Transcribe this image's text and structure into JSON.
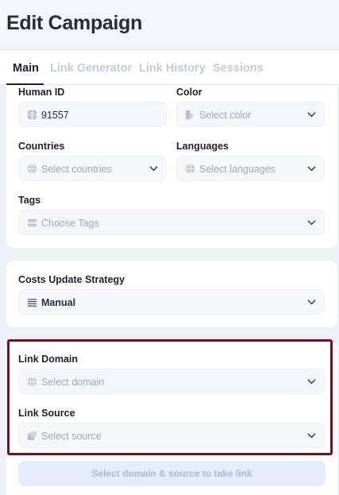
{
  "page_title": "Edit Campaign",
  "tabs": [
    {
      "label": "Main",
      "active": true
    },
    {
      "label": "Link Generator",
      "active": false
    },
    {
      "label": "Link History",
      "active": false
    },
    {
      "label": "Sessions",
      "active": false
    }
  ],
  "general": {
    "human_id": {
      "label": "Human ID",
      "value": "91557",
      "icon": "globe-icon"
    },
    "color": {
      "label": "Color",
      "placeholder": "Select color",
      "icon": "palette-icon"
    },
    "countries": {
      "label": "Countries",
      "placeholder": "Select countries",
      "icon": "globe-icon"
    },
    "languages": {
      "label": "Languages",
      "placeholder": "Select languages",
      "icon": "globe-icon"
    },
    "tags": {
      "label": "Tags",
      "placeholder": "Choose Tags",
      "icon": "tags-icon"
    }
  },
  "costs": {
    "label": "Costs Update Strategy",
    "value": "Manual",
    "icon": "list-icon"
  },
  "link": {
    "domain": {
      "label": "Link Domain",
      "placeholder": "Select domain",
      "icon": "globe-icon"
    },
    "source": {
      "label": "Link Source",
      "placeholder": "Select source",
      "icon": "source-icon"
    },
    "take_link_button": "Select domain & source to take link"
  },
  "colors": {
    "highlight_border": "#7a0e1a",
    "button_bg": "#e5ebfb",
    "button_text": "#a8b9e8",
    "active_tab": "#1f202c",
    "inactive_tab": "#c6c9d6"
  }
}
